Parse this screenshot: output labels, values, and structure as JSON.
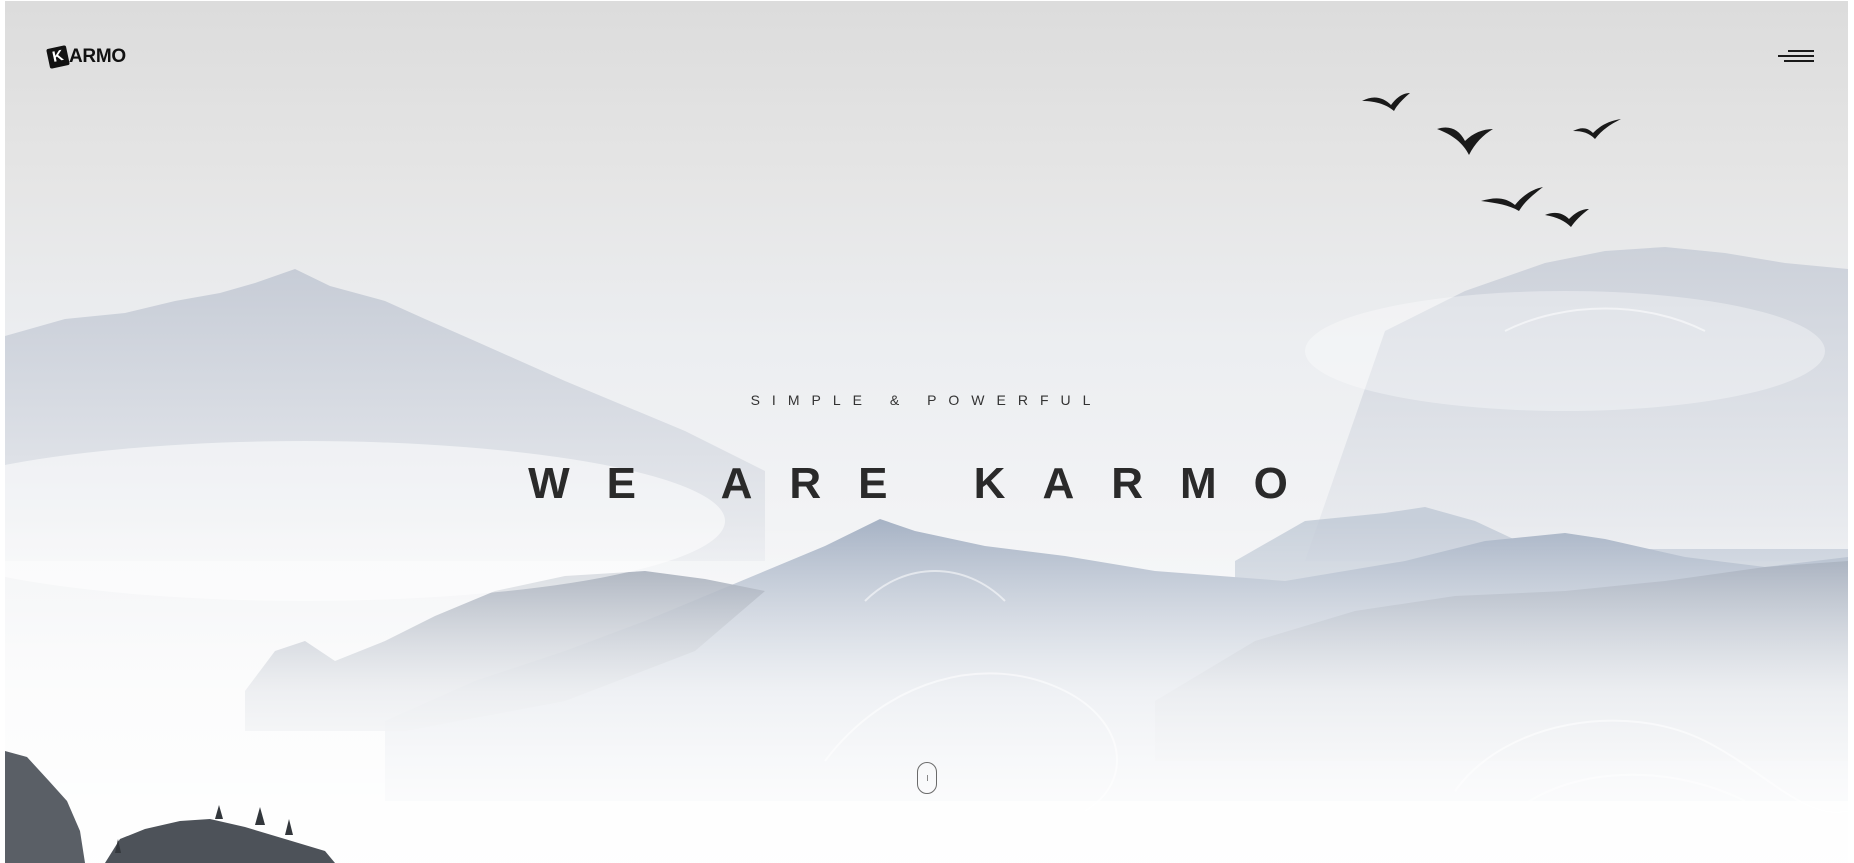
{
  "header": {
    "logo_mark": "K",
    "logo_text": "ARMO",
    "menu_icon": "hamburger-icon"
  },
  "hero": {
    "tagline": "SIMPLE & POWERFUL",
    "headline": "WE ARE KARMO",
    "scroll_icon": "mouse-scroll-icon"
  },
  "colors": {
    "text_dark": "#2a2a2a",
    "mountain_blue": "#aab6c8",
    "sky": "#e4e4e4"
  }
}
